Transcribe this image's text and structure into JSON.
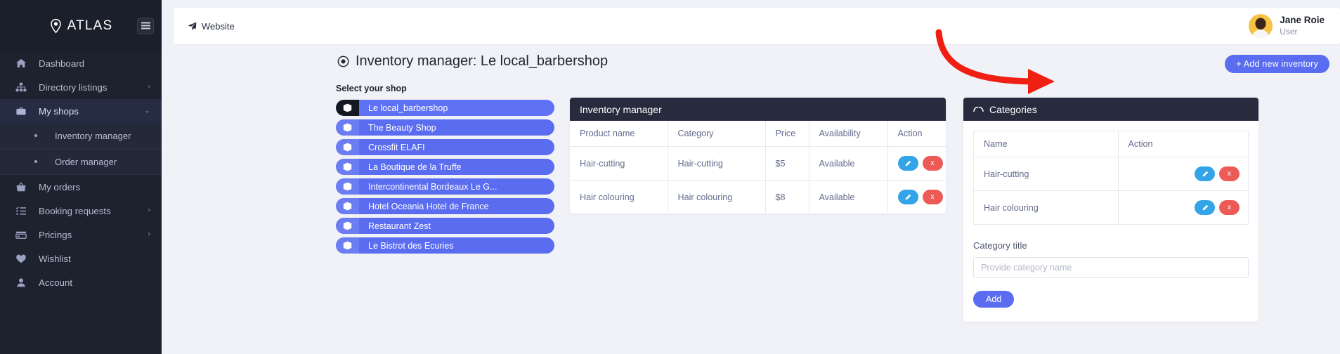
{
  "brand": {
    "name": "ATLAS",
    "logo_icon": "map-pin-icon",
    "menu_icon": "hamburger-icon"
  },
  "sidebar": {
    "items": [
      {
        "label": "Dashboard",
        "icon": "home-icon",
        "active": false,
        "chevron": ""
      },
      {
        "label": "Directory listings",
        "icon": "sitemap-icon",
        "active": false,
        "chevron": "›"
      },
      {
        "label": "My shops",
        "icon": "briefcase-icon",
        "active": true,
        "chevron": "⌄"
      },
      {
        "label": "My orders",
        "icon": "basket-icon",
        "active": false,
        "chevron": ""
      },
      {
        "label": "Booking requests",
        "icon": "checklist-icon",
        "active": false,
        "chevron": "›"
      },
      {
        "label": "Pricings",
        "icon": "card-icon",
        "active": false,
        "chevron": "›"
      },
      {
        "label": "Wishlist",
        "icon": "heart-icon",
        "active": false,
        "chevron": ""
      },
      {
        "label": "Account",
        "icon": "user-icon",
        "active": false,
        "chevron": ""
      }
    ],
    "sub_items": [
      {
        "label": "Inventory manager"
      },
      {
        "label": "Order manager"
      }
    ]
  },
  "topbar": {
    "website_label": "Website",
    "website_icon": "paper-plane-icon",
    "user_name": "Jane Roie",
    "user_role": "User",
    "avatar_icon": "avatar"
  },
  "page": {
    "title": "Inventory manager: Le local_barbershop",
    "title_icon": "target-icon",
    "add_button": "+ Add new inventory",
    "accent_color": "#5a6cf0",
    "arrow_color": "#ef1f14"
  },
  "shops": {
    "label": "Select your shop",
    "items": [
      {
        "name": "Le local_barbershop",
        "icon": "box-icon",
        "selected": true
      },
      {
        "name": "The Beauty Shop",
        "icon": "box-icon",
        "selected": false
      },
      {
        "name": "Crossfit ELAFI",
        "icon": "box-icon",
        "selected": false
      },
      {
        "name": "La Boutique de la Truffe",
        "icon": "box-icon",
        "selected": false
      },
      {
        "name": "Intercontinental Bordeaux Le G...",
        "icon": "box-icon",
        "selected": false
      },
      {
        "name": "Hotel Oceania Hotel de France",
        "icon": "box-icon",
        "selected": false
      },
      {
        "name": "Restaurant Zest",
        "icon": "box-icon",
        "selected": false
      },
      {
        "name": "Le Bistrot des Ecuries",
        "icon": "box-icon",
        "selected": false
      }
    ]
  },
  "inventory": {
    "title": "Inventory manager",
    "columns": [
      "Product name",
      "Category",
      "Price",
      "Availability",
      "Action"
    ],
    "rows": [
      {
        "product": "Hair-cutting",
        "category": "Hair-cutting",
        "price": "$5",
        "availability": "Available",
        "edit": "",
        "delete": "x"
      },
      {
        "product": "Hair colouring",
        "category": "Hair colouring",
        "price": "$8",
        "availability": "Available",
        "edit": "",
        "delete": "x"
      }
    ]
  },
  "categories": {
    "title": "Categories",
    "title_icon": "chart-icon",
    "columns": [
      "Name",
      "Action"
    ],
    "rows": [
      {
        "name": "Hair-cutting",
        "edit": "",
        "delete": "x"
      },
      {
        "name": "Hair colouring",
        "edit": "",
        "delete": "x"
      }
    ],
    "form": {
      "label": "Category title",
      "placeholder": "Provide category name",
      "value": "",
      "add_button": "Add"
    }
  }
}
